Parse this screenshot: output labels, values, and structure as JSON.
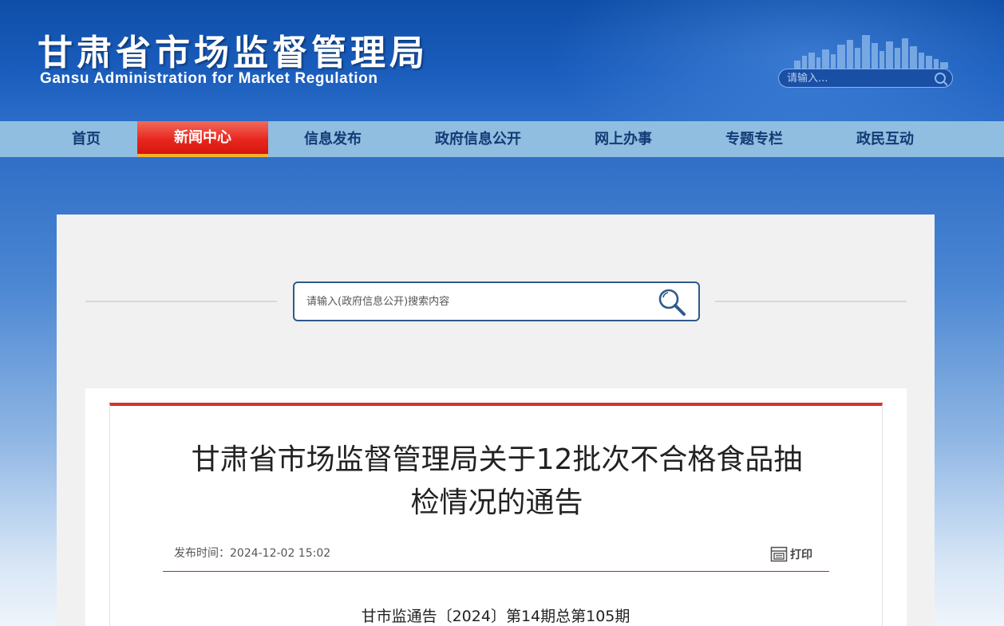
{
  "header": {
    "title_cn": "甘肃省市场监督管理局",
    "title_en": "Gansu Administration for Market Regulation",
    "search_placeholder": "请输入..."
  },
  "nav": {
    "items": [
      {
        "label": "首页",
        "active": false
      },
      {
        "label": "新闻中心",
        "active": true
      },
      {
        "label": "信息发布",
        "active": false
      },
      {
        "label": "政府信息公开",
        "active": false
      },
      {
        "label": "网上办事",
        "active": false
      },
      {
        "label": "专题专栏",
        "active": false
      },
      {
        "label": "政民互动",
        "active": false
      }
    ]
  },
  "search": {
    "placeholder": "请输入(政府信息公开)搜索内容"
  },
  "article": {
    "title_line1": "甘肃省市场监督管理局关于12批次不合格食品抽",
    "title_line2": "检情况的通告",
    "publish_label": "发布时间：",
    "publish_time": "2024-12-02 15:02",
    "print_label": "打印",
    "doc_number": "甘市监通告〔2024〕第14期总第105期"
  },
  "colors": {
    "header_blue": "#1a5dbd",
    "nav_bg": "#8fbee0",
    "nav_active": "#e8281f",
    "nav_active_underline": "#f7b22a",
    "article_accent": "#d6322d"
  }
}
